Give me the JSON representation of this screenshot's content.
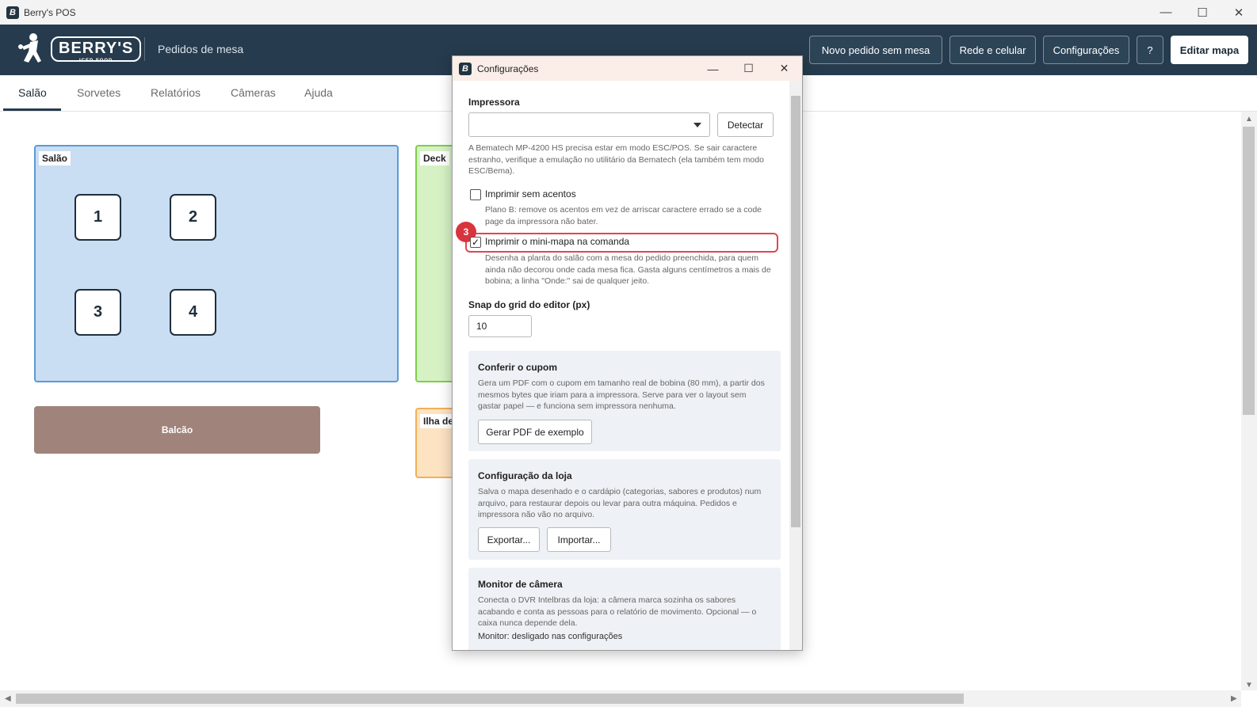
{
  "window": {
    "title": "Berry's POS",
    "controls": {
      "minimize": "—",
      "maximize": "☐",
      "close": "✕"
    }
  },
  "header": {
    "logo_text": "BERRY'S",
    "logo_subtext": "ICED FOOD",
    "section_title": "Pedidos de mesa",
    "buttons": {
      "new_order": "Novo pedido sem mesa",
      "network": "Rede e celular",
      "settings": "Configurações",
      "help": "?",
      "edit_map": "Editar mapa"
    }
  },
  "tabs": [
    "Salão",
    "Sorvetes",
    "Relatórios",
    "Câmeras",
    "Ajuda"
  ],
  "map": {
    "areas": {
      "salao": {
        "label": "Salão",
        "color": "#c9ddf3",
        "border": "#5b9bd5"
      },
      "deck": {
        "label": "Deck",
        "color": "#d6f2c5",
        "border": "#7ccf4a"
      },
      "ilha": {
        "label": "Ilha de",
        "color": "#fde3c2",
        "border": "#f2b057"
      },
      "balcao": {
        "label": "Balcão",
        "color": "#a0837a"
      }
    },
    "tables": [
      "1",
      "2",
      "3",
      "4"
    ]
  },
  "dialog": {
    "title": "Configurações",
    "printer": {
      "label": "Impressora",
      "selected": "",
      "detect_button": "Detectar",
      "help": "A Bematech MP-4200 HS precisa estar em modo ESC/POS. Se sair caractere estranho, verifique a emulação no utilitário da Bematech (ela também tem modo ESC/Bema)."
    },
    "no_accents": {
      "label": "Imprimir sem acentos",
      "checked": false,
      "help": "Plano B: remove os acentos em vez de arriscar caractere errado se a code page da impressora não bater."
    },
    "minimap": {
      "label": "Imprimir o mini-mapa na comanda",
      "checked": true,
      "check_glyph": "✓",
      "marker": "3",
      "help": "Desenha a planta do salão com a mesa do pedido preenchida, para quem ainda não decorou onde cada mesa fica. Gasta alguns centímetros a mais de bobina; a linha \"Onde:\" sai de qualquer jeito."
    },
    "grid_snap": {
      "label": "Snap do grid do editor (px)",
      "value": "10"
    },
    "receipt_panel": {
      "title": "Conferir o cupom",
      "help": "Gera um PDF com o cupom em tamanho real de bobina (80 mm), a partir dos mesmos bytes que iriam para a impressora. Serve para ver o layout sem gastar papel — e funciona sem impressora nenhuma.",
      "button": "Gerar PDF de exemplo"
    },
    "store_panel": {
      "title": "Configuração da loja",
      "help": "Salva o mapa desenhado e o cardápio (categorias, sabores e produtos) num arquivo, para restaurar depois ou levar para outra máquina. Pedidos e impressora não vão no arquivo.",
      "export_button": "Exportar...",
      "import_button": "Importar..."
    },
    "camera_panel": {
      "title": "Monitor de câmera",
      "help": "Conecta o DVR Intelbras da loja: a câmera marca sozinha os sabores acabando e conta as pessoas para o relatório de movimento. Opcional — o caixa nunca depende dela.",
      "status": "Monitor: desligado nas configurações"
    }
  }
}
